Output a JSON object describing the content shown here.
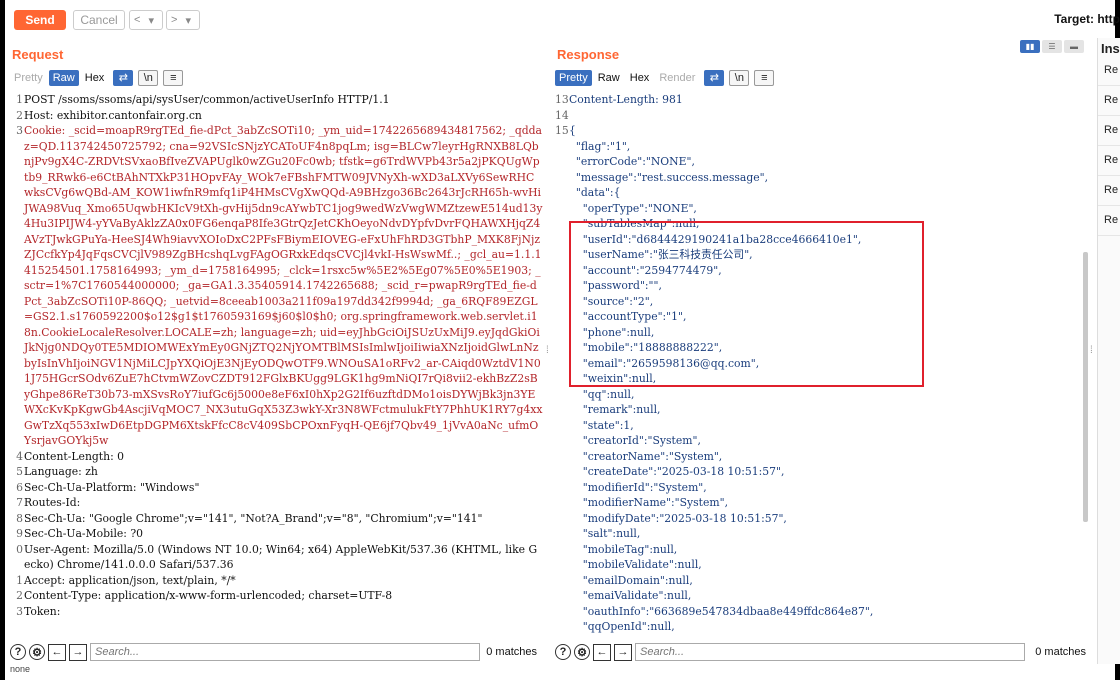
{
  "toolbar": {
    "send_label": "Send",
    "cancel_label": "Cancel",
    "back_glyph": "<",
    "back_menu_glyph": "▾",
    "fwd_glyph": ">",
    "fwd_menu_glyph": "▾",
    "target_label": "Target: http"
  },
  "request": {
    "title": "Request",
    "tabs": [
      "Pretty",
      "Raw",
      "Hex"
    ],
    "active_tab": "Raw",
    "tool_icons": [
      "wrap-icon",
      "newline-icon",
      "menu-icon"
    ],
    "tool_glyphs": [
      "⇄",
      "\\n",
      "≡"
    ],
    "lines": [
      {
        "n": "1",
        "t": "POST /ssoms/ssoms/api/sysUser/common/activeUserInfo HTTP/1.1",
        "c": "plain"
      },
      {
        "n": "2",
        "t": "Host: exhibitor.cantonfair.org.cn",
        "c": "plain"
      },
      {
        "n": "3",
        "t": "Cookie: _scid=moapR9rgTEd_fie-dPct_3abZcSOTi10; _ym_uid=1742265689434817562; _qddaz=QD.113742450725792; cna=92VSIcSNjzYCAToUF4n8pqLm; isg=BLCw7leyrHgRNXB8LQbnjPv9gX4C-ZRDVtSVxaoBfIveZVAPUglk0wZGu20Fc0wb; tfstk=g6TrdWVPb43r5a2jPKQUgWptb9_RRwk6-e6CtBAhNTXkP31HOpvFAy_WOk7eFBshFMTW09JVNyXh-wXD3aLXVy6SewRHCwksCVg6wQBd-AM_KOW1iwfnR9mfq1iP4HMsCVgXwQQd-A9BHzgo36Bc2643rJcRH65h-wvHiJWA98Vuq_Xmo65UqwbHKIcV9tXh-gvHij5dn9cAYwbTC1jog9wedWzVwgWMZtzewE514ud13y4Hu3IPIJW4-yYVaByAklzZA0x0FG6enqaP8Ife3GtrQzJetCKhOeyoNdvDYpfvDvrFQHAWXHjqZ4AVzTJwkGPuYa-HeeSJ4Wh9iavvXOIoDxC2PFsFBiymEIOVEG-eFxUhFhRD3GTbhP_MXK8FjNjzZJCcfkYp4JqFqsCVCjlV989ZgBHcshqLvgFAgOGRxkEdqsCVCjl4vkI-HsWswMf..; _gcl_au=1.1.1415254501.1758164993; _ym_d=1758164995; _clck=1rsxc5w%5E2%5Eg07%5E0%5E1903; _sctr=1%7C1760544000000; _ga=GA1.3.35405914.1742265688; _scid_r=pwapR9rgTEd_fie-dPct_3abZcSOTi10P-86QQ; _uetvid=8ceeab1003a211f09a197dd342f9994d; _ga_6RQF89EZGL=GS2.1.s1760592200$o12$g1$t1760593169$j60$l0$h0; org.springframework.web.servlet.i18n.CookieLocaleResolver.LOCALE=zh; language=zh; uid=eyJhbGciOiJSUzUxMiJ9.eyJqdGkiOiJkNjg0NDQy0TE5MDIOMWExYmEy0GNjZTQ2NjYOMTBlMSIsImlwIjoiIiwiaXNzIjoidGlwLnNzbyIsInVhIjoiNGV1NjMiLCJpYXQiOjE3NjEyODQwOTF9.WNOuSA1oRFv2_ar-CAiqd0WztdV1N01J75HGcrSOdv6ZuE7hCtvmWZovCZDT912FGlxBKUgg9LGK1hg9mNiQI7rQi8vii2-ekhBzZ2sByGhpe86ReT30b73-mXSvsRoY7iufGc6j5000e8eF6xI0hXp2G2If6uzftdDMo1oisDYWjBk3jn3YEWXcKvKpKgwGb4AscjiVqMOC7_NX3utuGqX53Z3wkY-Xr3N8WFctmulukFtY7PhhUK1RY7g4xxGwTzXq553xIwD6EtpDGPM6XtskFfcC8cV409SbCPOxnFyqH-QE6jf7Qbv49_1jVvA0aNc_ufmOYsrjavGOYkj5w",
        "c": "red"
      },
      {
        "n": "4",
        "t": "Content-Length: 0",
        "c": "plain"
      },
      {
        "n": "5",
        "t": "Language: zh",
        "c": "plain"
      },
      {
        "n": "6",
        "t": "Sec-Ch-Ua-Platform: \"Windows\"",
        "c": "plain"
      },
      {
        "n": "7",
        "t": "Routes-Id:",
        "c": "plain"
      },
      {
        "n": "8",
        "t": "Sec-Ch-Ua: \"Google Chrome\";v=\"141\", \"Not?A_Brand\";v=\"8\", \"Chromium\";v=\"141\"",
        "c": "plain"
      },
      {
        "n": "9",
        "t": "Sec-Ch-Ua-Mobile: ?0",
        "c": "plain"
      },
      {
        "n": "0",
        "t": "User-Agent: Mozilla/5.0 (Windows NT 10.0; Win64; x64) AppleWebKit/537.36 (KHTML, like Gecko) Chrome/141.0.0.0 Safari/537.36",
        "c": "plain"
      },
      {
        "n": "1",
        "t": "Accept: application/json, text/plain, */*",
        "c": "plain"
      },
      {
        "n": "2",
        "t": "Content-Type: application/x-www-form-urlencoded; charset=UTF-8",
        "c": "plain"
      },
      {
        "n": "3",
        "t": "Token:",
        "c": "plain"
      }
    ],
    "search_placeholder": "Search...",
    "matches": "0 matches"
  },
  "response": {
    "title": "Response",
    "tabs": [
      "Pretty",
      "Raw",
      "Hex",
      "Render"
    ],
    "active_tab": "Pretty",
    "tool_glyphs": [
      "⇄",
      "\\n",
      "≡"
    ],
    "lines": [
      {
        "n": "13",
        "t": "Content-Length: 981"
      },
      {
        "n": "14",
        "t": ""
      },
      {
        "n": "15",
        "t": "{"
      },
      {
        "n": "",
        "t": "  \"flag\":\"1\","
      },
      {
        "n": "",
        "t": "  \"errorCode\":\"NONE\","
      },
      {
        "n": "",
        "t": "  \"message\":\"rest.success.message\","
      },
      {
        "n": "",
        "t": "  \"data\":{"
      },
      {
        "n": "",
        "t": "    \"operType\":\"NONE\","
      },
      {
        "n": "",
        "t": "    \"subTablesMap\":null,"
      },
      {
        "n": "",
        "t": "    \"userId\":\"d6844429190241a1ba28cce4666410e1\","
      },
      {
        "n": "",
        "t": "    \"userName\":\"张三科技责任公司\","
      },
      {
        "n": "",
        "t": "    \"account\":\"2594774479\","
      },
      {
        "n": "",
        "t": "    \"password\":\"\","
      },
      {
        "n": "",
        "t": "    \"source\":\"2\","
      },
      {
        "n": "",
        "t": "    \"accountType\":\"1\","
      },
      {
        "n": "",
        "t": "    \"phone\":null,"
      },
      {
        "n": "",
        "t": "    \"mobile\":\"18888888222\","
      },
      {
        "n": "",
        "t": "    \"email\":\"2659598136@qq.com\","
      },
      {
        "n": "",
        "t": "    \"weixin\":null,"
      },
      {
        "n": "",
        "t": "    \"qq\":null,"
      },
      {
        "n": "",
        "t": "    \"remark\":null,"
      },
      {
        "n": "",
        "t": "    \"state\":1,"
      },
      {
        "n": "",
        "t": "    \"creatorId\":\"System\","
      },
      {
        "n": "",
        "t": "    \"creatorName\":\"System\","
      },
      {
        "n": "",
        "t": "    \"createDate\":\"2025-03-18 10:51:57\","
      },
      {
        "n": "",
        "t": "    \"modifierId\":\"System\","
      },
      {
        "n": "",
        "t": "    \"modifierName\":\"System\","
      },
      {
        "n": "",
        "t": "    \"modifyDate\":\"2025-03-18 10:51:57\","
      },
      {
        "n": "",
        "t": "    \"salt\":null,"
      },
      {
        "n": "",
        "t": "    \"mobileTag\":null,"
      },
      {
        "n": "",
        "t": "    \"mobileValidate\":null,"
      },
      {
        "n": "",
        "t": "    \"emailDomain\":null,"
      },
      {
        "n": "",
        "t": "    \"emaiValidate\":null,"
      },
      {
        "n": "",
        "t": "    \"oauthInfo\":\"663689e547834dbaa8e449ffdc864e87\","
      },
      {
        "n": "",
        "t": "    \"qqOpenId\":null,"
      }
    ],
    "search_placeholder": "Search...",
    "matches": "0 matches"
  },
  "inspector": {
    "title": "Ins",
    "items": [
      "Re",
      "Re",
      "Re",
      "Re",
      "Re",
      "Re"
    ]
  },
  "footer_text": "none",
  "colors": {
    "accent": "#ff6633",
    "tab_active": "#3a6fbf",
    "highlight_box": "#e0202c"
  }
}
